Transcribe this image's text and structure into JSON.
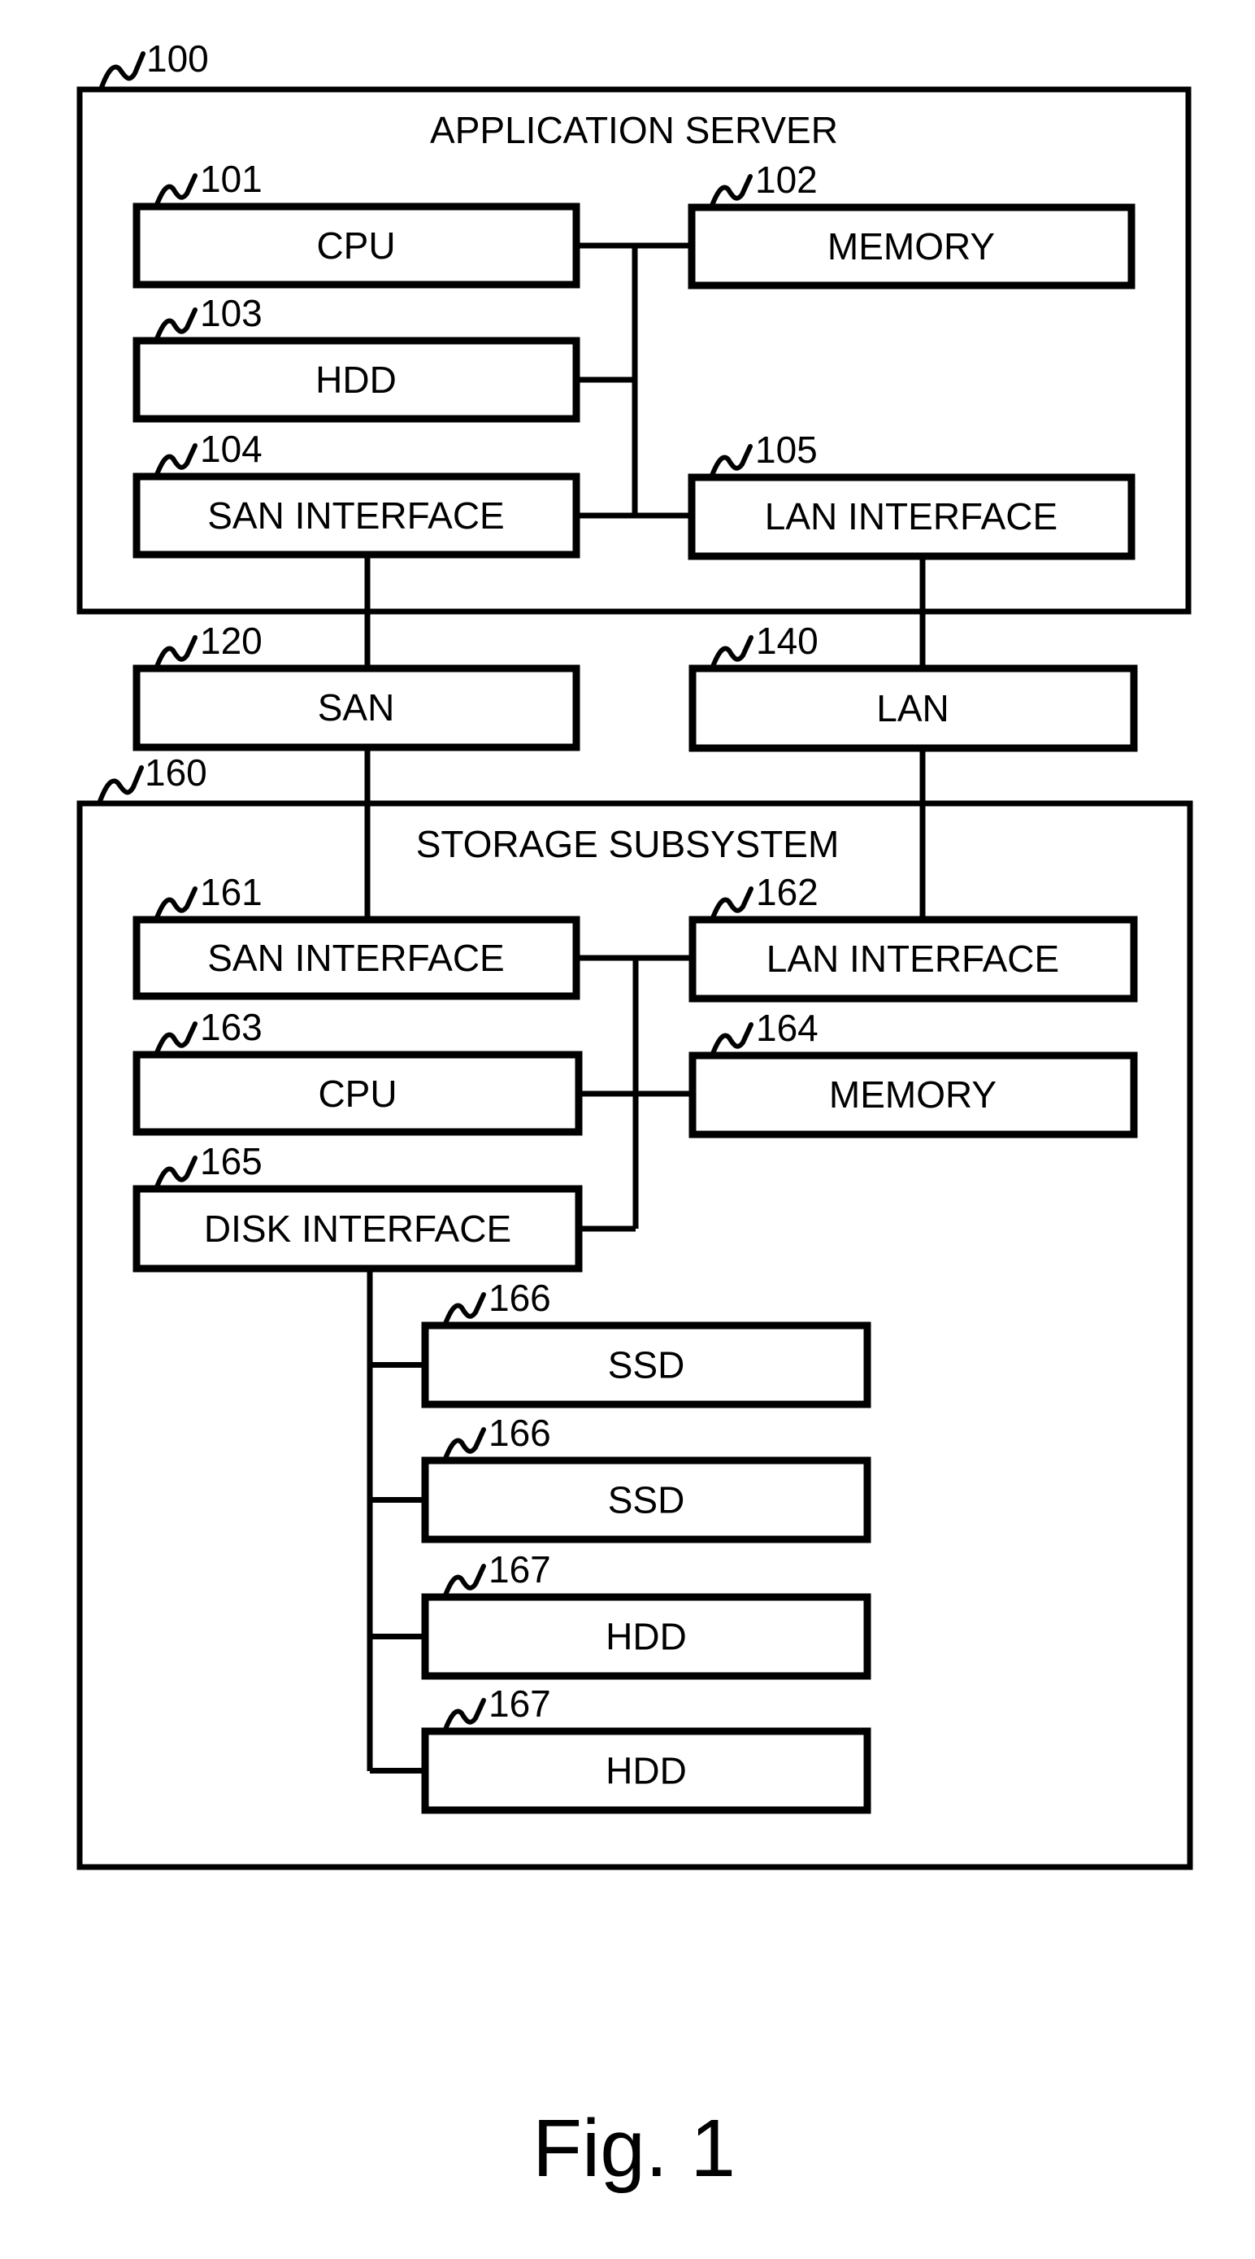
{
  "figure": {
    "caption": "Fig. 1",
    "application_server": {
      "ref": "100",
      "title": "APPLICATION SERVER",
      "components": {
        "cpu": {
          "ref": "101",
          "label": "CPU"
        },
        "memory": {
          "ref": "102",
          "label": "MEMORY"
        },
        "hdd": {
          "ref": "103",
          "label": "HDD"
        },
        "san_interface": {
          "ref": "104",
          "label": "SAN INTERFACE"
        },
        "lan_interface": {
          "ref": "105",
          "label": "LAN INTERFACE"
        }
      }
    },
    "networks": {
      "san": {
        "ref": "120",
        "label": "SAN"
      },
      "lan": {
        "ref": "140",
        "label": "LAN"
      }
    },
    "storage_subsystem": {
      "ref": "160",
      "title": "STORAGE SUBSYSTEM",
      "components": {
        "san_interface": {
          "ref": "161",
          "label": "SAN INTERFACE"
        },
        "lan_interface": {
          "ref": "162",
          "label": "LAN INTERFACE"
        },
        "cpu": {
          "ref": "163",
          "label": "CPU"
        },
        "memory": {
          "ref": "164",
          "label": "MEMORY"
        },
        "disk_interface": {
          "ref": "165",
          "label": "DISK INTERFACE"
        }
      },
      "drives": [
        {
          "ref": "166",
          "label": "SSD"
        },
        {
          "ref": "166",
          "label": "SSD"
        },
        {
          "ref": "167",
          "label": "HDD"
        },
        {
          "ref": "167",
          "label": "HDD"
        }
      ]
    }
  }
}
